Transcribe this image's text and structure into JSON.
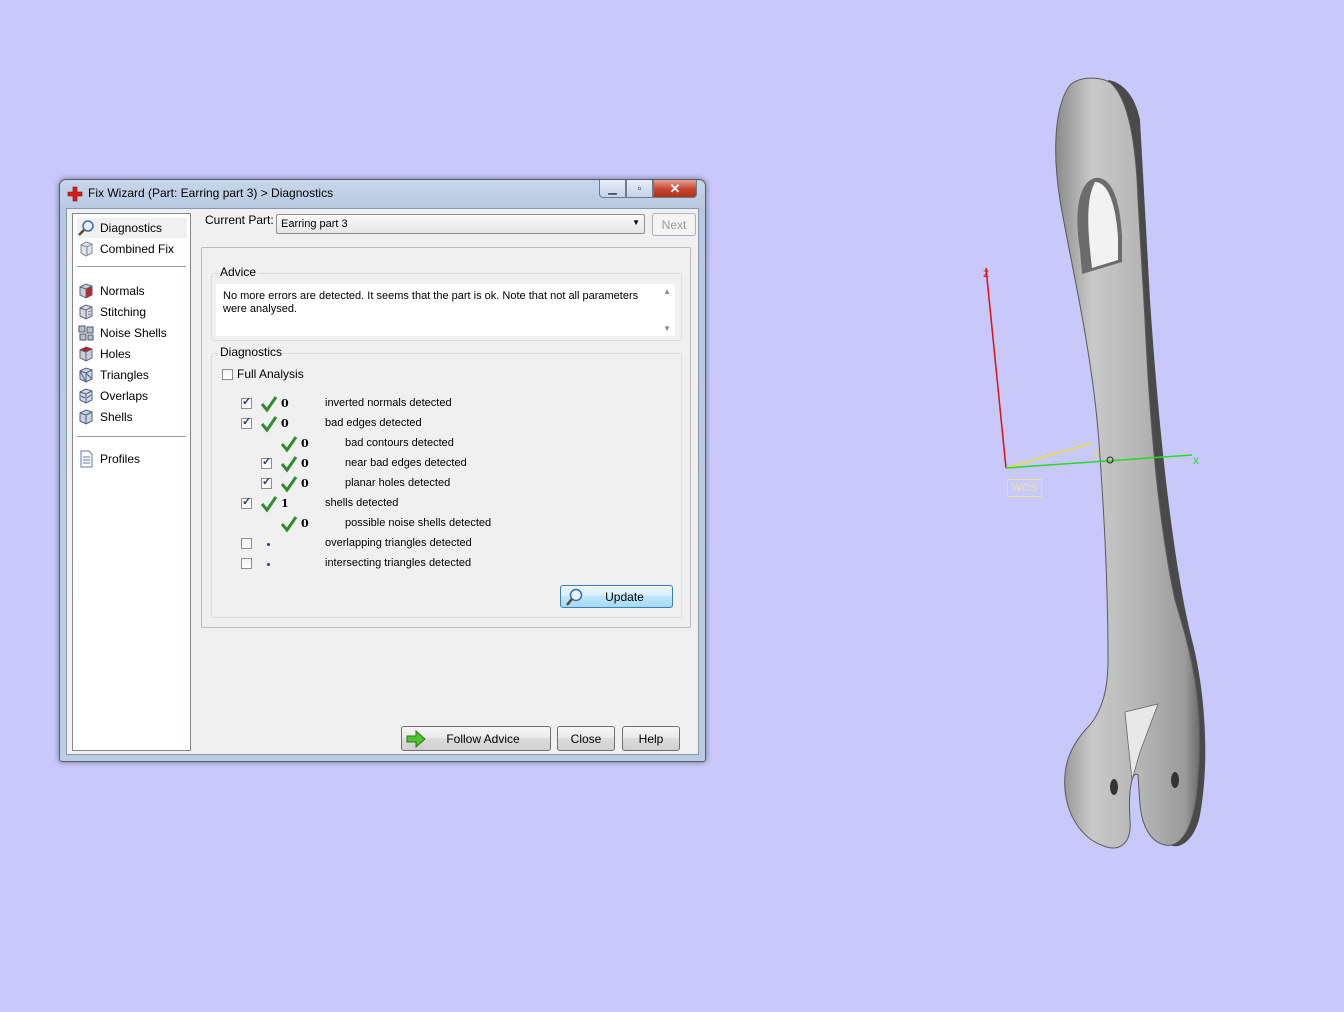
{
  "window": {
    "title": "Fix Wizard (Part: Earring part 3) > Diagnostics",
    "icon": "red-cross-icon"
  },
  "nav": {
    "items": [
      {
        "label": "Diagnostics",
        "icon": "magnifier-icon",
        "selected": true
      },
      {
        "label": "Combined Fix",
        "icon": "cube-icon"
      },
      {
        "label": "Normals",
        "icon": "normals-cube-icon"
      },
      {
        "label": "Stitching",
        "icon": "stitching-cube-icon"
      },
      {
        "label": "Noise Shells",
        "icon": "noise-shells-icon"
      },
      {
        "label": "Holes",
        "icon": "holes-cube-icon"
      },
      {
        "label": "Triangles",
        "icon": "triangles-cube-icon"
      },
      {
        "label": "Overlaps",
        "icon": "overlaps-cube-icon"
      },
      {
        "label": "Shells",
        "icon": "shells-cube-icon"
      },
      {
        "label": "Profiles",
        "icon": "document-icon"
      }
    ]
  },
  "top": {
    "current_part_label": "Current Part:",
    "current_part_value": "Earring part 3",
    "next_label": "Next"
  },
  "advice": {
    "title": "Advice",
    "text": "No more errors are detected. It seems that the part is ok. Note that not all parameters were analysed."
  },
  "diagnostics": {
    "title": "Diagnostics",
    "full_analysis_label": "Full Analysis",
    "rows": [
      {
        "checked": true,
        "status": "ok",
        "count": "0",
        "label": "inverted normals detected"
      },
      {
        "checked": true,
        "status": "ok",
        "count": "0",
        "label": "bad edges detected"
      },
      {
        "checked": null,
        "status": "ok",
        "count": "0",
        "label": "bad contours detected"
      },
      {
        "checked": true,
        "status": "ok",
        "count": "0",
        "label": "near bad edges detected"
      },
      {
        "checked": true,
        "status": "ok",
        "count": "0",
        "label": "planar holes detected"
      },
      {
        "checked": true,
        "status": "ok",
        "count": "1",
        "label": "shells detected"
      },
      {
        "checked": null,
        "status": "ok",
        "count": "0",
        "label": "possible noise shells detected"
      },
      {
        "checked": false,
        "status": "pending",
        "count": "",
        "label": "overlapping triangles detected"
      },
      {
        "checked": false,
        "status": "pending",
        "count": "",
        "label": "intersecting triangles detected"
      }
    ],
    "update_label": "Update"
  },
  "footer": {
    "follow_advice_label": "Follow Advice",
    "close_label": "Close",
    "help_label": "Help"
  },
  "scene": {
    "axis_x_label": "x",
    "axis_y_label": "y",
    "axis_z_label": "z",
    "wcs_label": "WCS",
    "colors": {
      "background": "#c8c8fa",
      "x_axis": "#22dd22",
      "y_axis": "#e8e040",
      "z_axis": "#dd1111",
      "part": "#a8a8a8"
    }
  }
}
